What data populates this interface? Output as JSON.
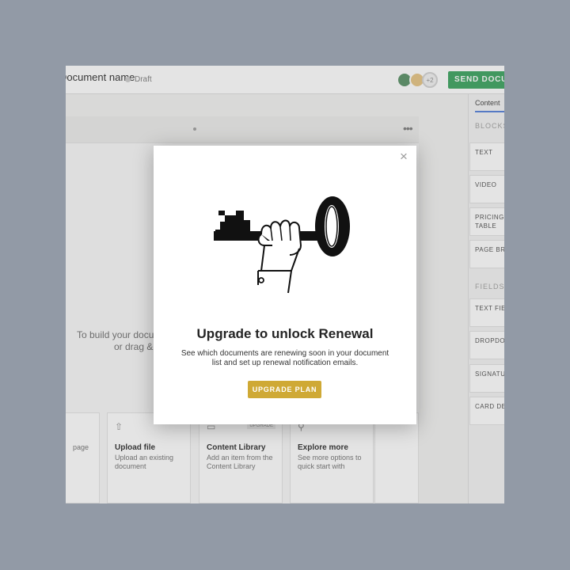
{
  "topbar": {
    "doc_name": "Document name",
    "status": "Draft",
    "avatar_more": "+2",
    "send_label": "SEND DOCUMENT"
  },
  "doc": {
    "hint_line1": "To build your document, click blocks",
    "hint_line2": "or drag & drop"
  },
  "cards": [
    {
      "title": "",
      "desc": "page"
    },
    {
      "title": "Upload file",
      "desc": "Upload an existing document"
    },
    {
      "title": "Content Library",
      "desc": "Add an item from the Content Library",
      "badge": "UPGRADE"
    },
    {
      "title": "Explore more",
      "desc": "See more options to quick start with"
    }
  ],
  "sidebar": {
    "tab": "Content",
    "blocks_heading": "BLOCKS",
    "blocks": [
      "TEXT",
      "VIDEO",
      "PRICING TABLE",
      "PAGE BREAK"
    ],
    "fields_heading": "FIELDS",
    "fields": [
      "TEXT FIELD",
      "DROPDOWN",
      "SIGNATURE",
      "CARD DETAILS"
    ]
  },
  "modal": {
    "title": "Upgrade to unlock Renewal",
    "description": "See which documents are renewing soon in your document list and set up renewal notification emails.",
    "button": "UPGRADE PLAN",
    "close_symbol": "×"
  },
  "colors": {
    "accent_send": "#2f9e55",
    "accent_upgrade": "#cfa935",
    "backdrop": "#929aa6"
  }
}
